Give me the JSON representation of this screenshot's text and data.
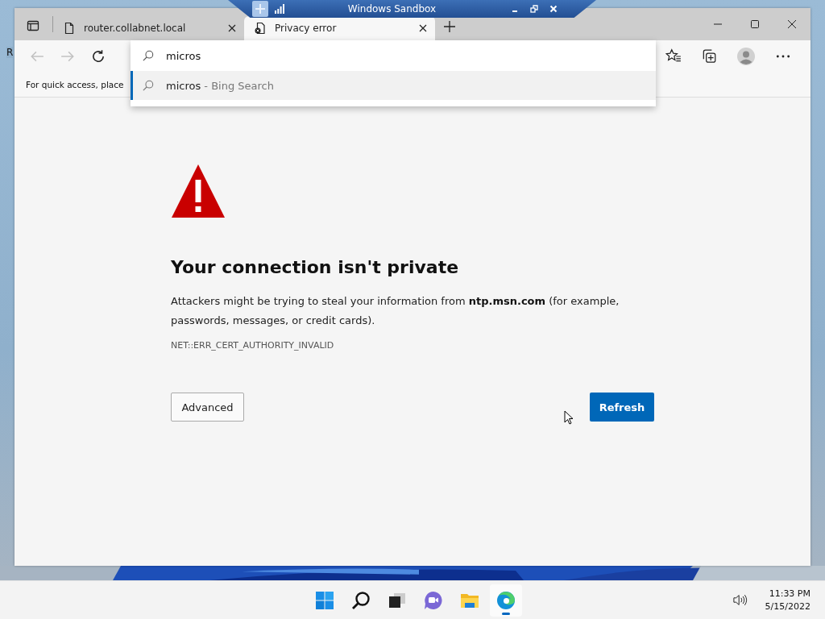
{
  "desktop": {
    "icon_label": "R"
  },
  "sandbox_bar": {
    "title": "Windows Sandbox"
  },
  "tabs": [
    {
      "title": "router.collabnet.local",
      "selected": false,
      "kind": "page"
    },
    {
      "title": "Privacy error",
      "selected": true,
      "kind": "warning"
    }
  ],
  "toolbar": {
    "back_disabled": true,
    "forward_disabled": true
  },
  "favorites_bar": {
    "text": "For quick access, place"
  },
  "omnibox": {
    "value": "micros",
    "suggestions": [
      {
        "query": "micros",
        "suffix": "- Bing Search",
        "selected": true
      }
    ]
  },
  "error_page": {
    "heading": "Your connection isn't private",
    "message": "Attackers might be trying to steal your information from **ntp.msn.com** (for example, passwords, messages, or credit cards).",
    "code": "NET::ERR_CERT_AUTHORITY_INVALID",
    "buttons": [
      {
        "label": "Advanced",
        "kind": "secondary"
      },
      {
        "label": "Refresh",
        "kind": "primary"
      }
    ]
  },
  "taskbar": {
    "apps": [
      {
        "kind": "start",
        "selected": false
      },
      {
        "kind": "search",
        "selected": false
      },
      {
        "kind": "taskview",
        "selected": false
      },
      {
        "kind": "chat",
        "selected": false
      },
      {
        "kind": "explorer",
        "selected": false
      },
      {
        "kind": "edge",
        "selected": true
      }
    ],
    "time": "11:33 PM",
    "date": "5/15/2022"
  }
}
